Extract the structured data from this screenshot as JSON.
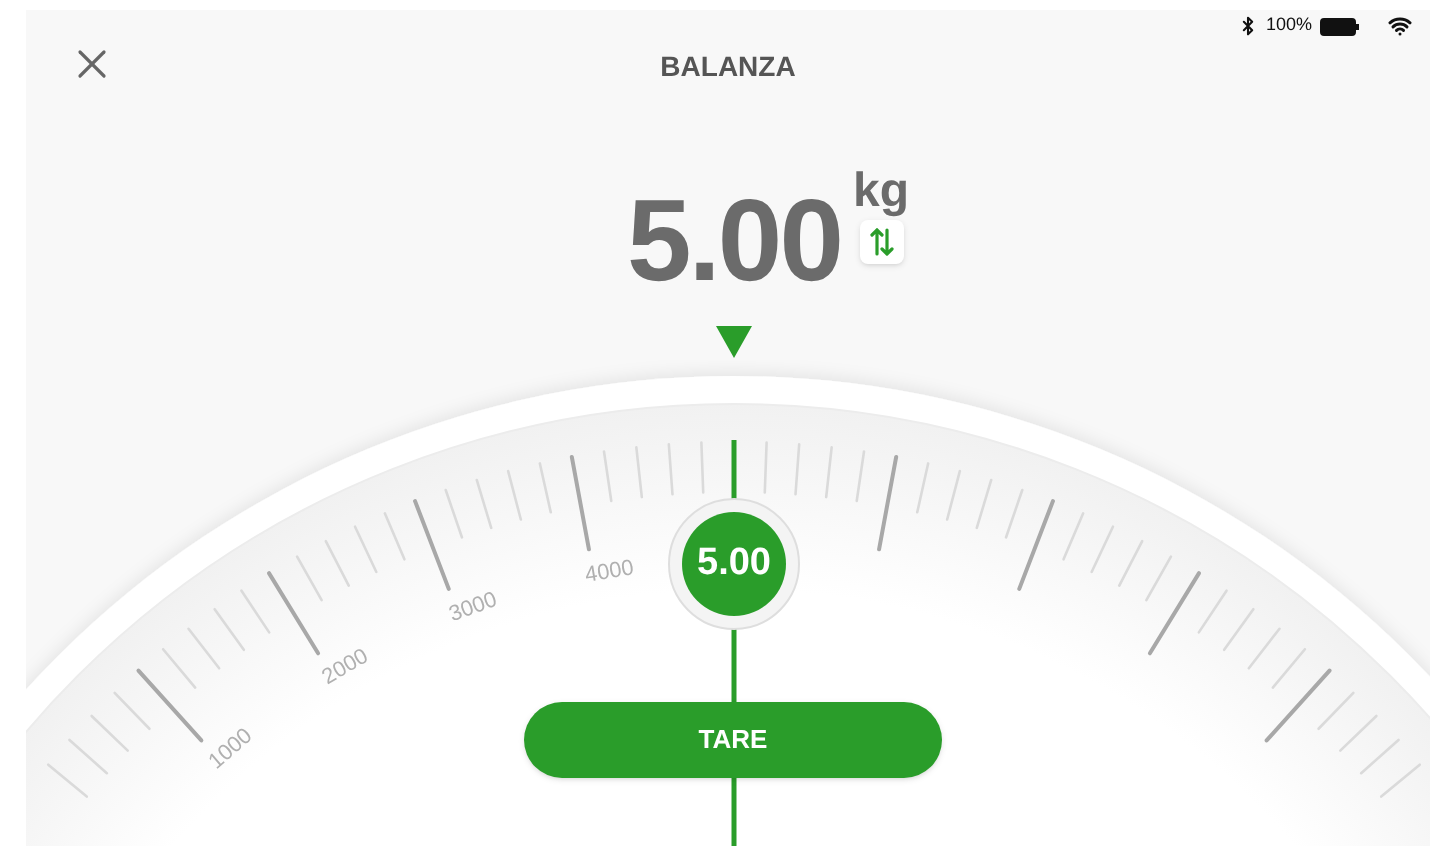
{
  "status_bar": {
    "battery": "100%"
  },
  "header": {
    "title": "BALANZA"
  },
  "reading": {
    "value": "5.00",
    "unit": "kg"
  },
  "dial": {
    "labels": [
      "1000",
      "2000",
      "3000",
      "4000"
    ],
    "needle_value": "5.00"
  },
  "tare_button": {
    "label": "TARE"
  }
}
